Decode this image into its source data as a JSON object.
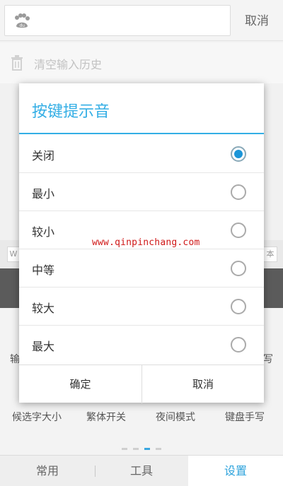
{
  "top_bar": {
    "search_placeholder": "",
    "cancel_label": "取消"
  },
  "history": {
    "clear_label": "清空输入历史"
  },
  "candidate_bar": {
    "left_fragment": "W",
    "right_fragment": "本"
  },
  "settings_panel": {
    "left_peek": "输",
    "right_peek": "写",
    "tiles": [
      {
        "label": "候选字大小"
      },
      {
        "label": "繁体开关"
      },
      {
        "label": "夜间模式"
      },
      {
        "label": "键盘手写"
      }
    ],
    "page_dots": {
      "count": 4,
      "active_index": 2
    }
  },
  "tabs": [
    {
      "label": "常用",
      "active": false
    },
    {
      "label": "工具",
      "active": false
    },
    {
      "label": "设置",
      "active": true
    }
  ],
  "dialog": {
    "title": "按键提示音",
    "options": [
      {
        "label": "关闭",
        "checked": true
      },
      {
        "label": "最小",
        "checked": false
      },
      {
        "label": "较小",
        "checked": false
      },
      {
        "label": "中等",
        "checked": false
      },
      {
        "label": "较大",
        "checked": false
      },
      {
        "label": "最大",
        "checked": false
      }
    ],
    "confirm_label": "确定",
    "cancel_label": "取消"
  },
  "watermark": "www.qinpinchang.com",
  "colors": {
    "accent": "#33aee5",
    "radio_checked": "#1b95d8",
    "watermark": "#d01818"
  },
  "icons": {
    "search_logo": "baidu-paw-icon",
    "clear_history": "trash-icon"
  }
}
